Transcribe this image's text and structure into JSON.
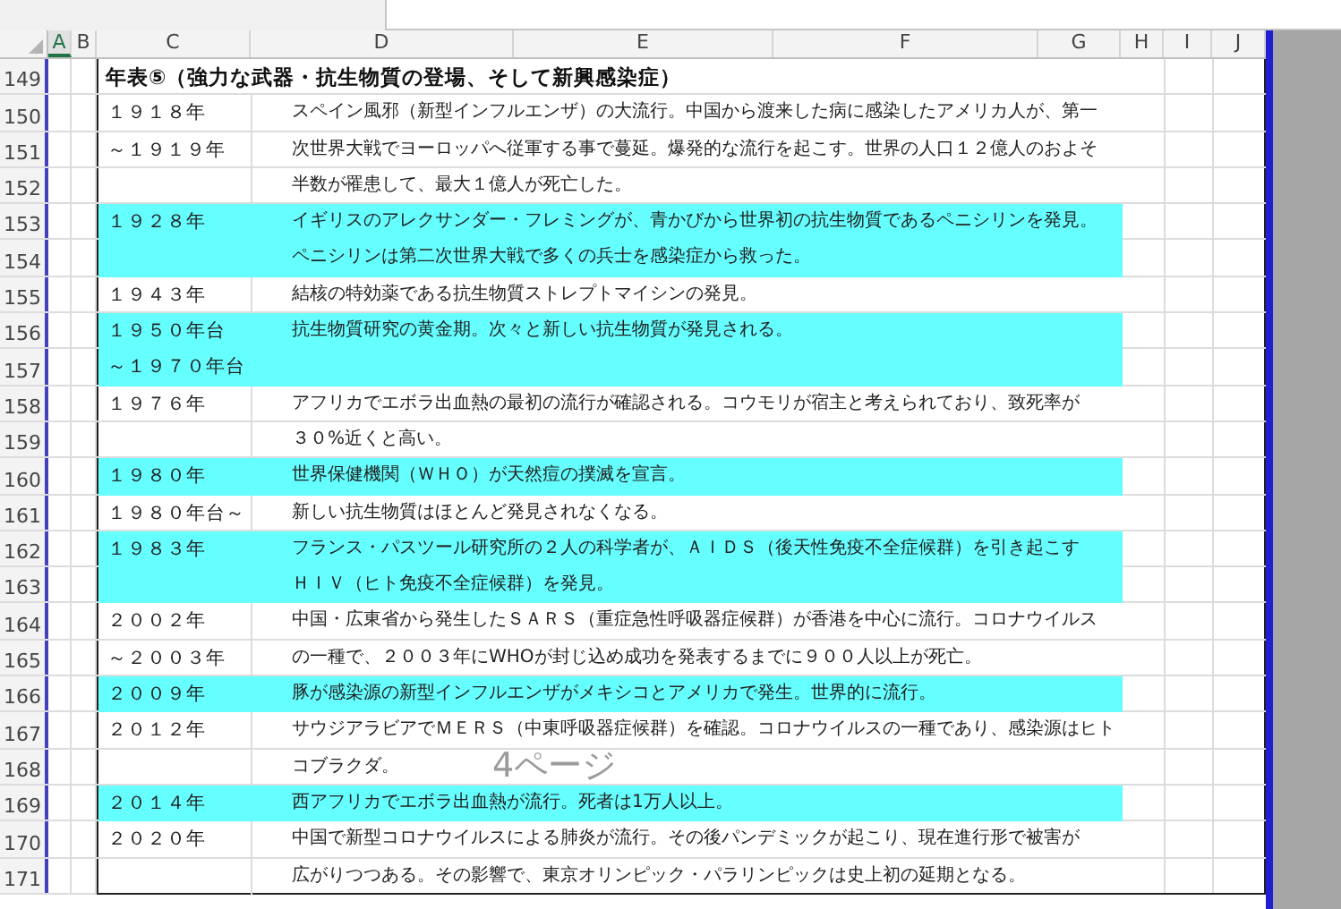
{
  "columns": [
    {
      "label": "A",
      "selected": true
    },
    {
      "label": "B",
      "selected": false
    },
    {
      "label": "C",
      "selected": false
    },
    {
      "label": "D",
      "selected": false
    },
    {
      "label": "E",
      "selected": false
    },
    {
      "label": "F",
      "selected": false
    },
    {
      "label": "G",
      "selected": false
    },
    {
      "label": "H",
      "selected": false
    },
    {
      "label": "I",
      "selected": false
    },
    {
      "label": "J",
      "selected": false
    }
  ],
  "title_row": {
    "row": "149",
    "text": "年表⑤（強力な武器・抗生物質の登場、そして新興感染症）"
  },
  "rows": [
    {
      "row": "150",
      "year": "１９１８年",
      "text": "スペイン風邪（新型インフルエンザ）の大流行。中国から渡来した病に感染したアメリカ人が、第一",
      "highlighted": false
    },
    {
      "row": "151",
      "year": "～１９１９年",
      "text": "次世界大戦でヨーロッパへ従軍する事で蔓延。爆発的な流行を起こす。世界の人口１２億人のおよそ",
      "highlighted": false
    },
    {
      "row": "152",
      "year": "",
      "text": "半数が罹患して、最大１億人が死亡した。",
      "highlighted": false
    },
    {
      "row": "153",
      "year": "１９２８年",
      "text": "イギリスのアレクサンダー・フレミングが、青かびから世界初の抗生物質であるペニシリンを発見。",
      "highlighted": true
    },
    {
      "row": "154",
      "year": "",
      "text": "ペニシリンは第二次世界大戦で多くの兵士を感染症から救った。",
      "highlighted": true
    },
    {
      "row": "155",
      "year": "１９４３年",
      "text": "結核の特効薬である抗生物質ストレプトマイシンの発見。",
      "highlighted": false
    },
    {
      "row": "156",
      "year": "１９５０年台",
      "text": "抗生物質研究の黄金期。次々と新しい抗生物質が発見される。",
      "highlighted": true
    },
    {
      "row": "157",
      "year": "～１９７０年台",
      "text": "",
      "highlighted": true
    },
    {
      "row": "158",
      "year": "１９７６年",
      "text": "アフリカでエボラ出血熱の最初の流行が確認される。コウモリが宿主と考えられており、致死率が",
      "highlighted": false
    },
    {
      "row": "159",
      "year": "",
      "text": "３０%近くと高い。",
      "highlighted": false
    },
    {
      "row": "160",
      "year": "１９８０年",
      "text": "世界保健機関（ＷＨＯ）が天然痘の撲滅を宣言。",
      "highlighted": true
    },
    {
      "row": "161",
      "year": "１９８０年台～",
      "text": "新しい抗生物質はほとんど発見されなくなる。",
      "highlighted": false
    },
    {
      "row": "162",
      "year": "１９８３年",
      "text": "フランス・パスツール研究所の２人の科学者が、ＡＩＤＳ（後天性免疫不全症候群）を引き起こす",
      "highlighted": true
    },
    {
      "row": "163",
      "year": "",
      "text": "ＨＩＶ（ヒト免疫不全症候群）を発見。",
      "highlighted": true
    },
    {
      "row": "164",
      "year": "２００２年",
      "text": "中国・広東省から発生したＳＡＲＳ（重症急性呼吸器症候群）が香港を中心に流行。コロナウイルス",
      "highlighted": false
    },
    {
      "row": "165",
      "year": "～２００３年",
      "text": "の一種で、２００３年にWHOが封じ込め成功を発表するまでに９００人以上が死亡。",
      "highlighted": false
    },
    {
      "row": "166",
      "year": "２００９年",
      "text": "豚が感染源の新型インフルエンザがメキシコとアメリカで発生。世界的に流行。",
      "highlighted": true
    },
    {
      "row": "167",
      "year": "２０１２年",
      "text": "サウジアラビアでＭＥＲＳ（中東呼吸器症候群）を確認。コロナウイルスの一種であり、感染源はヒト",
      "highlighted": false
    },
    {
      "row": "168",
      "year": "",
      "text": "コブラクダ。",
      "highlighted": false
    },
    {
      "row": "169",
      "year": "２０１４年",
      "text": "西アフリカでエボラ出血熱が流行。死者は1万人以上。",
      "highlighted": true
    },
    {
      "row": "170",
      "year": "２０２０年",
      "text": "中国で新型コロナウイルスによる肺炎が流行。その後パンデミックが起こり、現在進行形で被害が",
      "highlighted": false
    },
    {
      "row": "171",
      "year": "",
      "text": "広がりつつある。その影響で、東京オリンピック・パラリンピックは史上初の延期となる。",
      "highlighted": false
    }
  ],
  "page_label": "4ページ"
}
